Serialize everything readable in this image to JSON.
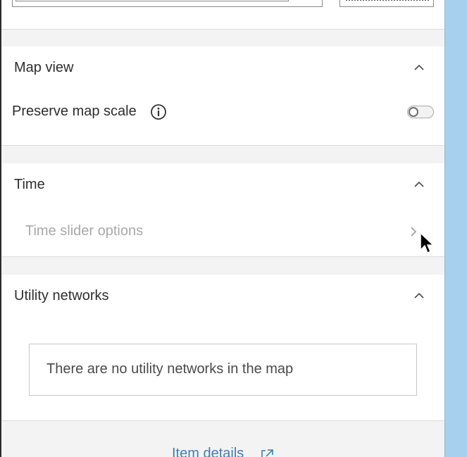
{
  "sections": {
    "map_view": {
      "title": "Map view",
      "preserve_scale_label": "Preserve map scale",
      "preserve_scale_on": false
    },
    "time": {
      "title": "Time",
      "slider_options_label": "Time slider options"
    },
    "utility_networks": {
      "title": "Utility networks",
      "empty_message": "There are no utility networks in the map"
    }
  },
  "footer": {
    "item_details_label": "Item details"
  },
  "colors": {
    "panel_bg": "#f3f3f3",
    "section_bg": "#ffffff",
    "link": "#3d7fb6",
    "map_water": "#a6d0ee",
    "disabled_text": "#a9a9a9"
  },
  "icons": [
    "chevron-up-icon",
    "info-icon",
    "chevron-right-icon",
    "external-link-icon",
    "mouse-cursor-icon"
  ]
}
